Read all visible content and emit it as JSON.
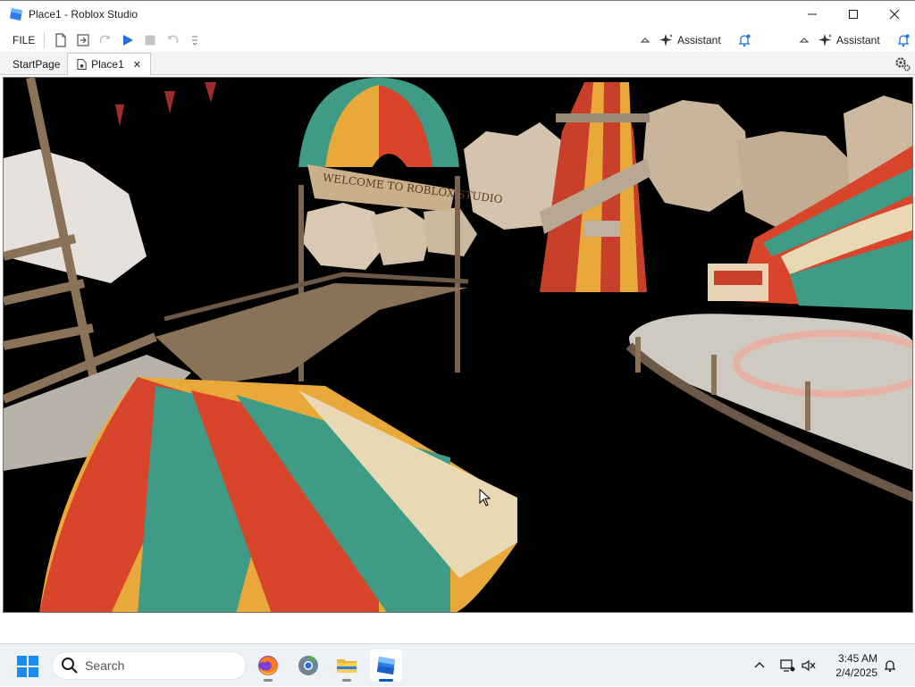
{
  "window": {
    "title": "Place1 - Roblox Studio",
    "controls": {
      "minimize": "minimize",
      "maximize": "maximize",
      "close": "close"
    }
  },
  "toolbar": {
    "file_label": "FILE",
    "assistant_label_1": "Assistant",
    "assistant_label_2": "Assistant"
  },
  "tabs": [
    {
      "label": "StartPage",
      "active": false
    },
    {
      "label": "Place1",
      "active": true,
      "close": "✕"
    }
  ],
  "viewport": {
    "banner_text": "WELCOME TO ROBLOX STUDIO"
  },
  "taskbar": {
    "search_placeholder": "Search",
    "apps": [
      "firefox-icon",
      "chrome-icon",
      "file-explorer-icon",
      "roblox-studio-icon"
    ],
    "clock_time": "3:45 AM",
    "clock_date": "2/4/2025"
  },
  "colors": {
    "accent": "#005fb8",
    "roblox_blue": "#2d7ce8",
    "tent_red": "#d9452a",
    "tent_teal": "#3f9b86",
    "tent_yellow": "#e8a93a",
    "tent_cream": "#e9d8b4",
    "wood": "#8a7258"
  }
}
